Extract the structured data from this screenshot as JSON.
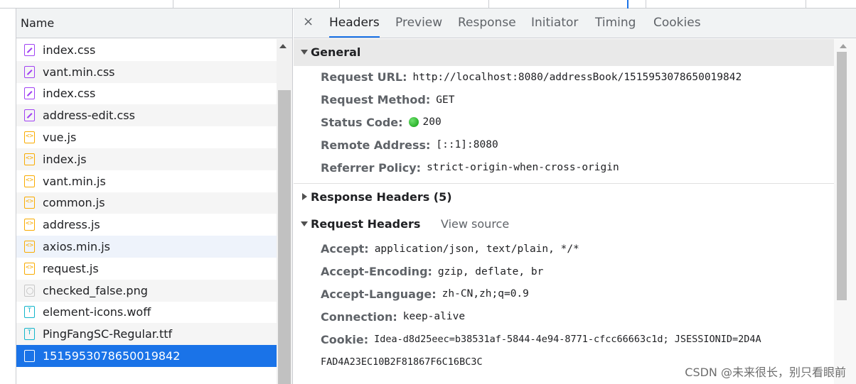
{
  "name_panel": {
    "header": "Name",
    "files": [
      {
        "name": "index.css",
        "type": "css"
      },
      {
        "name": "vant.min.css",
        "type": "css"
      },
      {
        "name": "index.css",
        "type": "css"
      },
      {
        "name": "address-edit.css",
        "type": "css"
      },
      {
        "name": "vue.js",
        "type": "js"
      },
      {
        "name": "index.js",
        "type": "js"
      },
      {
        "name": "vant.min.js",
        "type": "js"
      },
      {
        "name": "common.js",
        "type": "js"
      },
      {
        "name": "address.js",
        "type": "js"
      },
      {
        "name": "axios.min.js",
        "type": "js"
      },
      {
        "name": "request.js",
        "type": "js"
      },
      {
        "name": "checked_false.png",
        "type": "img"
      },
      {
        "name": "element-icons.woff",
        "type": "font"
      },
      {
        "name": "PingFangSC-Regular.ttf",
        "type": "font"
      },
      {
        "name": "1515953078650019842",
        "type": "doc"
      }
    ]
  },
  "tabs": {
    "close": "×",
    "headers": "Headers",
    "preview": "Preview",
    "response": "Response",
    "initiator": "Initiator",
    "timing": "Timing",
    "cookies": "Cookies"
  },
  "general": {
    "title": "General",
    "request_url_label": "Request URL:",
    "request_url": "http://localhost:8080/addressBook/1515953078650019842",
    "request_method_label": "Request Method:",
    "request_method": "GET",
    "status_code_label": "Status Code:",
    "status_code": "200",
    "remote_address_label": "Remote Address:",
    "remote_address": "[::1]:8080",
    "referrer_policy_label": "Referrer Policy:",
    "referrer_policy": "strict-origin-when-cross-origin"
  },
  "response_headers": {
    "title": "Response Headers (5)"
  },
  "request_headers": {
    "title": "Request Headers",
    "view_source": "View source",
    "accept_label": "Accept:",
    "accept": "application/json, text/plain, */*",
    "accept_encoding_label": "Accept-Encoding:",
    "accept_encoding": "gzip, deflate, br",
    "accept_language_label": "Accept-Language:",
    "accept_language": "zh-CN,zh;q=0.9",
    "connection_label": "Connection:",
    "connection": "keep-alive",
    "cookie_label": "Cookie:",
    "cookie_line1": "Idea-d8d25eec=b38531af-5844-4e94-8771-cfcc66663c1d; JSESSIONID=2D4A",
    "cookie_line2": "FAD4A23EC10B2F81867F6C16BC3C"
  },
  "watermark": "CSDN @未来很长，别只看眼前",
  "colors": {
    "accent": "#1a73e8",
    "css_icon": "#a142f4",
    "js_icon": "#f9ab00",
    "font_icon": "#12b5cb",
    "status_ok": "#0f9d0f"
  }
}
